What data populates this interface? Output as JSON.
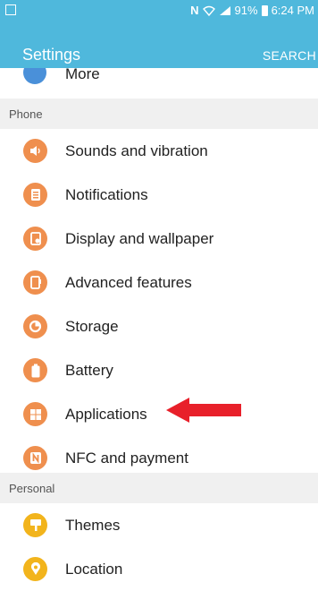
{
  "status_bar": {
    "nfc_glyph": "N",
    "battery_percent": "91%",
    "time": "6:24 PM"
  },
  "app_bar": {
    "title": "Settings",
    "search_label": "SEARCH"
  },
  "partial_item": {
    "label": "More",
    "icon": "more-icon"
  },
  "sections": [
    {
      "header": "Phone",
      "items": [
        {
          "label": "Sounds and vibration",
          "icon": "speaker-icon",
          "color": "#ef8f4e"
        },
        {
          "label": "Notifications",
          "icon": "notifications-icon",
          "color": "#ef8f4e"
        },
        {
          "label": "Display and wallpaper",
          "icon": "display-icon",
          "color": "#ef8f4e"
        },
        {
          "label": "Advanced features",
          "icon": "advanced-features-icon",
          "color": "#ef8f4e"
        },
        {
          "label": "Storage",
          "icon": "storage-icon",
          "color": "#ef8f4e"
        },
        {
          "label": "Battery",
          "icon": "battery-icon",
          "color": "#ef8f4e"
        },
        {
          "label": "Applications",
          "icon": "applications-icon",
          "color": "#ef8f4e"
        },
        {
          "label": "NFC and payment",
          "icon": "nfc-icon",
          "color": "#ef8f4e"
        }
      ]
    },
    {
      "header": "Personal",
      "items": [
        {
          "label": "Themes",
          "icon": "themes-icon",
          "color": "#f2b41c"
        },
        {
          "label": "Location",
          "icon": "location-icon",
          "color": "#f2b41c"
        }
      ]
    }
  ],
  "colors": {
    "accent": "#4fb8dc",
    "arrow": "#e8202a",
    "header_bg": "#f0f0f0"
  }
}
